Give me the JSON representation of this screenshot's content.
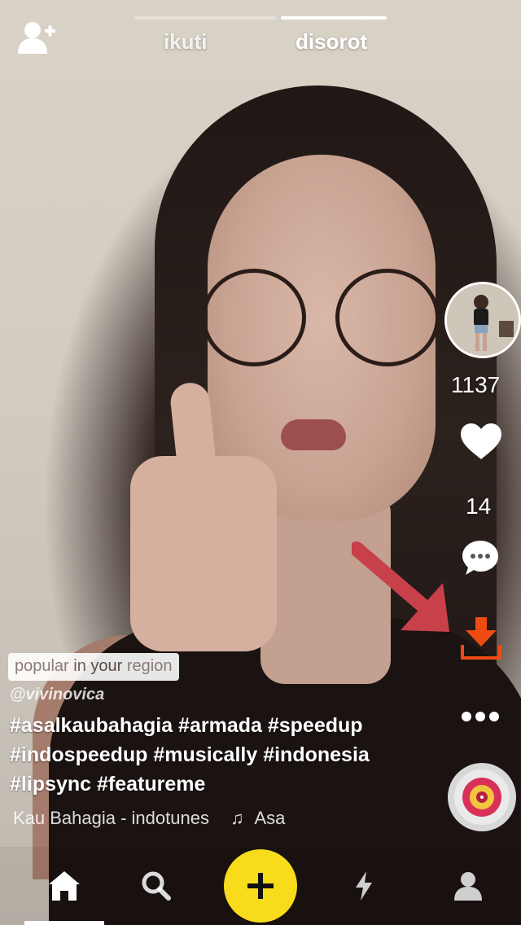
{
  "header": {
    "tabs": [
      {
        "label": "ikuti",
        "active": false
      },
      {
        "label": "disorot",
        "active": true
      }
    ],
    "add_user_icon": "add-user-icon"
  },
  "sidebar": {
    "avatar_icon": "profile-avatar",
    "like_count": "1137",
    "like_icon": "heart-icon",
    "comment_count": "14",
    "comment_icon": "comment-bubble-icon",
    "download_icon": "download-icon",
    "more_icon": "more-dots-icon",
    "music_disc_icon": "music-disc-icon",
    "annotation_arrow_color": "#c8404a",
    "download_color": "#ee4b13"
  },
  "caption": {
    "badge_part1": "popular",
    "badge_part2": "in",
    "badge_part3": "your",
    "badge_part4": "region",
    "username": "@vivinovica",
    "hashtags_line1": "#asalkaubahagia #armada #speedup",
    "hashtags_line2": "#indospeedup #musically #indonesia",
    "hashtags_line3": "#lipsync #featureme",
    "song": "Kau Bahagia - indotunes",
    "artist": "Asa"
  },
  "bottom_nav": {
    "items": [
      {
        "icon": "home-icon",
        "active": true
      },
      {
        "icon": "search-icon",
        "active": false
      },
      {
        "icon": "plus-icon",
        "active": false
      },
      {
        "icon": "lightning-icon",
        "active": false
      },
      {
        "icon": "profile-icon",
        "active": false
      }
    ],
    "plus_color": "#f8dc1c"
  }
}
